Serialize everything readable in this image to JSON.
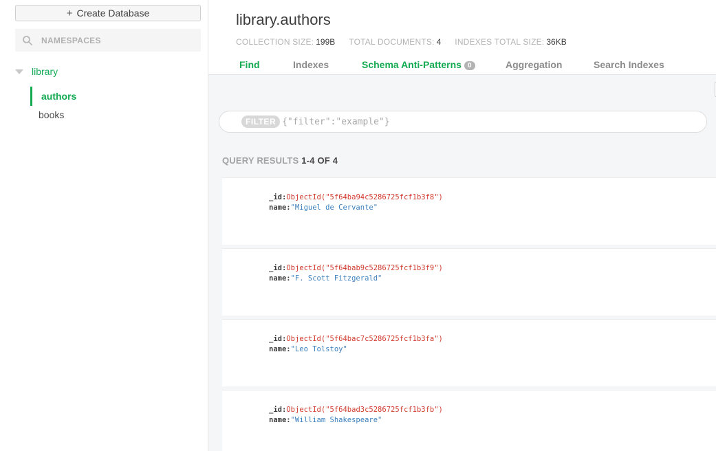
{
  "sidebar": {
    "create_database_label": "Create Database",
    "namespaces_placeholder": "NAMESPACES",
    "database": "library",
    "collections": [
      "authors",
      "books"
    ]
  },
  "header": {
    "title": "library.authors",
    "stats": {
      "collection_size_label": "COLLECTION SIZE:",
      "collection_size_value": "199B",
      "total_documents_label": "TOTAL DOCUMENTS:",
      "total_documents_value": "4",
      "indexes_total_size_label": "INDEXES TOTAL SIZE:",
      "indexes_total_size_value": "36KB"
    },
    "tabs": {
      "find": "Find",
      "indexes": "Indexes",
      "schema_anti_patterns": "Schema Anti-Patterns",
      "schema_anti_patterns_count": "0",
      "aggregation": "Aggregation",
      "search_indexes": "Search Indexes"
    }
  },
  "filter": {
    "label": "FILTER",
    "placeholder": "{\"filter\":\"example\"}"
  },
  "query_results": {
    "label": "QUERY RESULTS",
    "range": "1-4 OF 4"
  },
  "documents": [
    {
      "id_key": "_id:",
      "id_value": "ObjectId(\"5f64ba94c5286725fcf1b3f8\")",
      "name_key": "name:",
      "name_value": "\"Miguel de Cervante\""
    },
    {
      "id_key": "_id:",
      "id_value": "ObjectId(\"5f64bab9c5286725fcf1b3f9\")",
      "name_key": "name:",
      "name_value": "\"F. Scott Fitzgerald\""
    },
    {
      "id_key": "_id:",
      "id_value": "ObjectId(\"5f64bac7c5286725fcf1b3fa\")",
      "name_key": "name:",
      "name_value": "\"Leo Tolstoy\""
    },
    {
      "id_key": "_id:",
      "id_value": "ObjectId(\"5f64bad3c5286725fcf1b3fb\")",
      "name_key": "name:",
      "name_value": "\"William Shakespeare\""
    }
  ],
  "colors": {
    "accent_green": "#13aa52",
    "objectid_red": "#d23b2f",
    "string_blue": "#3c80bd"
  },
  "icons": {
    "namespaces": "search-icon",
    "database_toggle": "caret-down-icon",
    "create_database": "plus-icon"
  }
}
